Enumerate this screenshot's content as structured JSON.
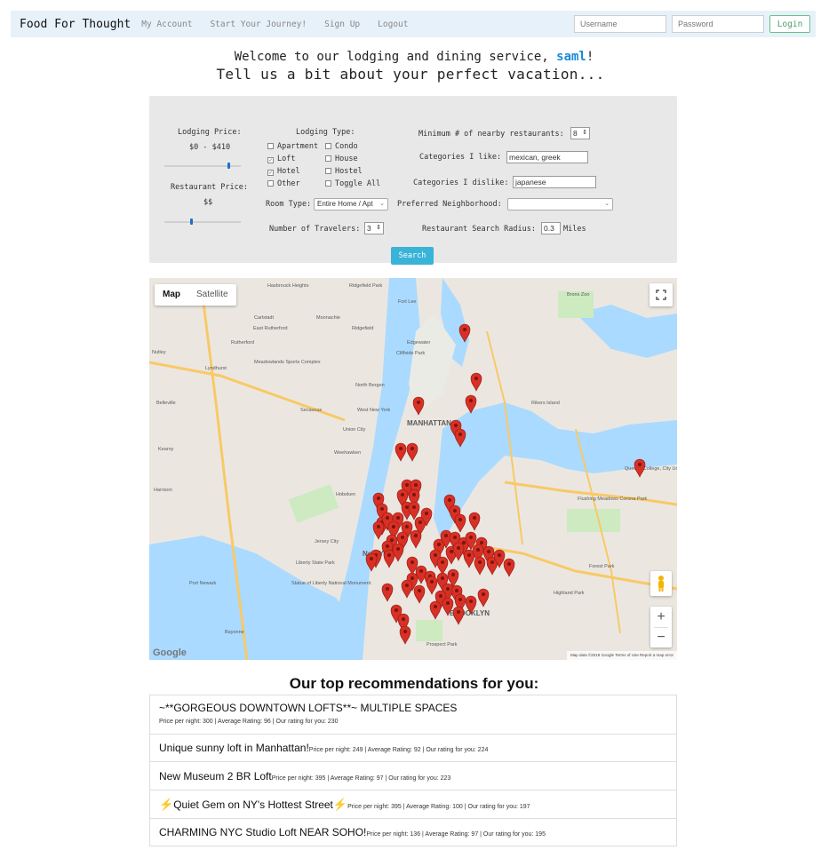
{
  "nav": {
    "brand": "Food For Thought",
    "links": [
      "My Account",
      "Start Your Journey!",
      "Sign Up",
      "Logout"
    ],
    "username_placeholder": "Username",
    "password_placeholder": "Password",
    "login_label": "Login"
  },
  "welcome": {
    "prefix": "Welcome to our lodging and dining service, ",
    "username": "saml",
    "suffix": "!",
    "subtitle": "Tell us a bit about your perfect vacation..."
  },
  "form": {
    "lodging_price_label": "Lodging Price:",
    "lodging_price_value": "$0 - $410",
    "restaurant_price_label": "Restaurant Price:",
    "restaurant_price_value": "$$",
    "lodging_price_fraction": 0.82,
    "restaurant_price_fraction": 0.34,
    "lodging_type_label": "Lodging Type:",
    "lodging_types": [
      {
        "label": "Apartment",
        "checked": false
      },
      {
        "label": "Condo",
        "checked": false
      },
      {
        "label": "Loft",
        "checked": true
      },
      {
        "label": "House",
        "checked": false
      },
      {
        "label": "Hotel",
        "checked": true
      },
      {
        "label": "Hostel",
        "checked": false
      },
      {
        "label": "Other",
        "checked": false
      },
      {
        "label": "Toggle All",
        "checked": false
      }
    ],
    "room_type_label": "Room Type:",
    "room_type_value": "Entire Home / Apt",
    "min_restaurants_label": "Minimum # of nearby restaurants:",
    "min_restaurants_value": "8",
    "categories_like_label": "Categories I like:",
    "categories_like_value": "mexican, greek",
    "categories_dislike_label": "Categories I dislike:",
    "categories_dislike_value": "japanese",
    "neighborhood_label": "Preferred Neighborhood:",
    "neighborhood_value": "",
    "travelers_label": "Number of Travelers:",
    "travelers_value": "3",
    "radius_label": "Restaurant Search Radius:",
    "radius_value": "0.3",
    "radius_unit": "Miles",
    "search_label": "Search"
  },
  "map": {
    "type_map": "Map",
    "type_satellite": "Satellite",
    "footer": "Map data ©2018 Google   Terms of Use   Report a map error",
    "logo": "Google",
    "labels": [
      "Hasbrouck Heights",
      "Ridgefield Park",
      "Fort Lee",
      "Bronx Zoo",
      "Carlstadt",
      "Moonachie",
      "East Rutherford",
      "Rutherford",
      "Nutley",
      "Lyndhurst",
      "Meadowlands Sports Complex",
      "Ridgefield",
      "Cliffside Park",
      "Edgewater",
      "North Bergen",
      "Belleville",
      "Secaucus",
      "West New York",
      "MANHATTAN",
      "Union City",
      "Weehawken",
      "Kearny",
      "Rikers Island",
      "Harrison",
      "Hoboken",
      "Jersey City",
      "New York",
      "Flushing Meadows Corona Park",
      "Queens College, City University of New York",
      "Liberty State Park",
      "Statue of Liberty National Monument",
      "Port Newark",
      "BROOKLYN",
      "Prospect Park",
      "Forest Park",
      "Highland Park",
      "Bayonne"
    ],
    "pin_color": "#d93025"
  },
  "recommendations": {
    "title": "Our top recommendations for you:",
    "items": [
      {
        "name": "~**GORGEOUS DOWNTOWN LOFTS**~ MULTIPLE SPACES",
        "meta": "Price per night: 300 | Average Rating: 96 | Our rating for you: 230",
        "stacked": true
      },
      {
        "name": "Unique sunny loft in Manhattan!",
        "meta": "Price per night: 249 | Average Rating: 92 | Our rating for you: 224",
        "stacked": false
      },
      {
        "name": "New Museum 2 BR Loft",
        "meta": "Price per night: 395 | Average Rating: 97 | Our rating for you: 223",
        "stacked": false
      },
      {
        "name": "Quiet Gem on NY's Hottest Street",
        "meta": "Price per night: 395 | Average Rating: 100 | Our rating for you: 197",
        "stacked": false,
        "bolts": true
      },
      {
        "name": "CHARMING NYC Studio Loft NEAR SOHO!",
        "meta": "Price per night: 136 | Average Rating: 97 | Our rating for you: 195",
        "stacked": false
      }
    ]
  },
  "colors": {
    "navbar_bg": "#e6f1fa",
    "accent_blue": "#1a8bd6",
    "search_button": "#3ab3d9",
    "login_green": "#49a06a",
    "panel_bg": "#e8e8e8"
  }
}
